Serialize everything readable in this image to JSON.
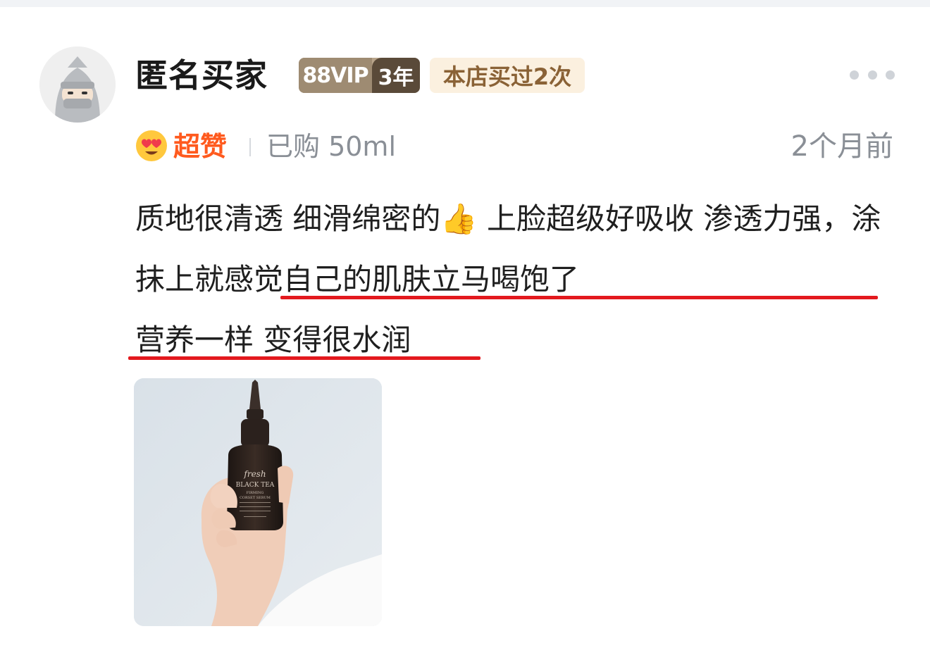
{
  "review": {
    "username": "匿名买家",
    "vip_label": "88VIP",
    "vip_years": "3年",
    "purchase_badge": "本店买过2次",
    "rating_label": "超赞",
    "purchased_spec": "已购 50ml",
    "time_ago": "2个月前",
    "text_part1": "质地很清透 细滑绵密的",
    "text_emoji": "👍",
    "text_part2": " 上脸超级好吸收 渗透力强，",
    "text_highlight1": "涂抹上就感觉自己的肌肤立马喝饱了",
    "text_highlight2": "营养一样 变得很水润",
    "photo": {
      "brand": "fresh",
      "product_line1": "BLACK TEA",
      "product_line2": "FIRMING",
      "product_line3": "CORSET SERUM"
    }
  },
  "colors": {
    "highlight_underline": "#e3191e",
    "rating_orange": "#ff5a1e",
    "muted_text": "#8a8f96"
  },
  "icons": {
    "rating": "heart-eyes-emoji-icon",
    "more": "more-dots-icon",
    "avatar": "anonymous-ninja-avatar-icon"
  }
}
